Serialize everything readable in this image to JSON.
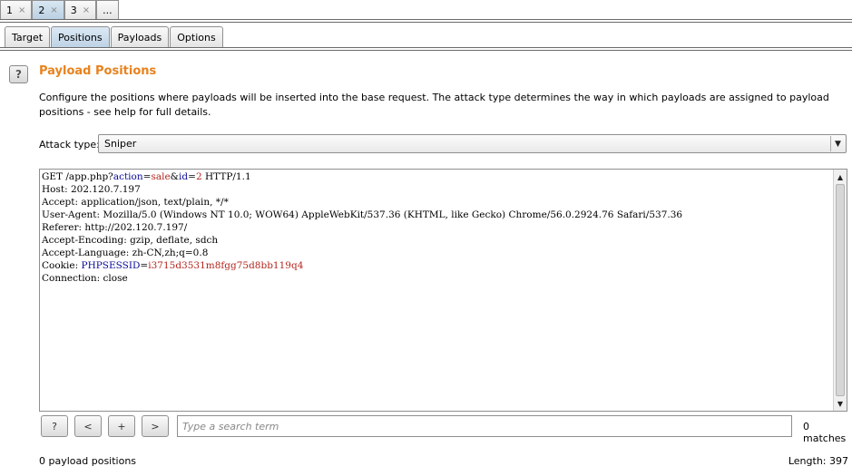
{
  "attack_tabs": [
    {
      "label": "1",
      "close": "×",
      "active": false
    },
    {
      "label": "2",
      "close": "×",
      "active": true
    },
    {
      "label": "3",
      "close": "×",
      "active": false
    },
    {
      "label": "...",
      "close": "",
      "active": false
    }
  ],
  "sub_tabs": [
    "Target",
    "Positions",
    "Payloads",
    "Options"
  ],
  "help_icon": "?",
  "section": {
    "title": "Payload Positions",
    "description": "Configure the positions where payloads will be inserted into the base request. The attack type determines the way in which payloads are assigned to payload positions - see help for full details."
  },
  "attack_type": {
    "label": "Attack type:",
    "value": "Sniper"
  },
  "request": {
    "line1_pre": "GET /app.php?",
    "line1_p1_name": "action",
    "line1_eq1": "=",
    "line1_p1_val": "sale",
    "line1_amp": "&",
    "line1_p2_name": "id",
    "line1_eq2": "=",
    "line1_p2_val": "2",
    "line1_post": " HTTP/1.1",
    "line2": "Host: 202.120.7.197",
    "line3": "Accept: application/json, text/plain, */*",
    "line4": "User-Agent: Mozilla/5.0 (Windows NT 10.0; WOW64) AppleWebKit/537.36 (KHTML, like Gecko) Chrome/56.0.2924.76 Safari/537.36",
    "line5": "Referer: http://202.120.7.197/",
    "line6": "Accept-Encoding: gzip, deflate, sdch",
    "line7": "Accept-Language: zh-CN,zh;q=0.8",
    "line8_pre": "Cookie: ",
    "line8_name": "PHPSESSID",
    "line8_eq": "=",
    "line8_val": "i3715d3531m8fgg75d8bb119q4",
    "line9": "Connection: close"
  },
  "search_bar": {
    "help": "?",
    "prev": "<",
    "add": "+",
    "next": ">",
    "placeholder": "Type a search term",
    "matches": "0 matches"
  },
  "status": {
    "positions": "0 payload positions",
    "length": "Length: 397"
  },
  "colors": {
    "title": "#e8821e",
    "param_name": "#0a0a9a",
    "param_value": "#b3261e"
  }
}
